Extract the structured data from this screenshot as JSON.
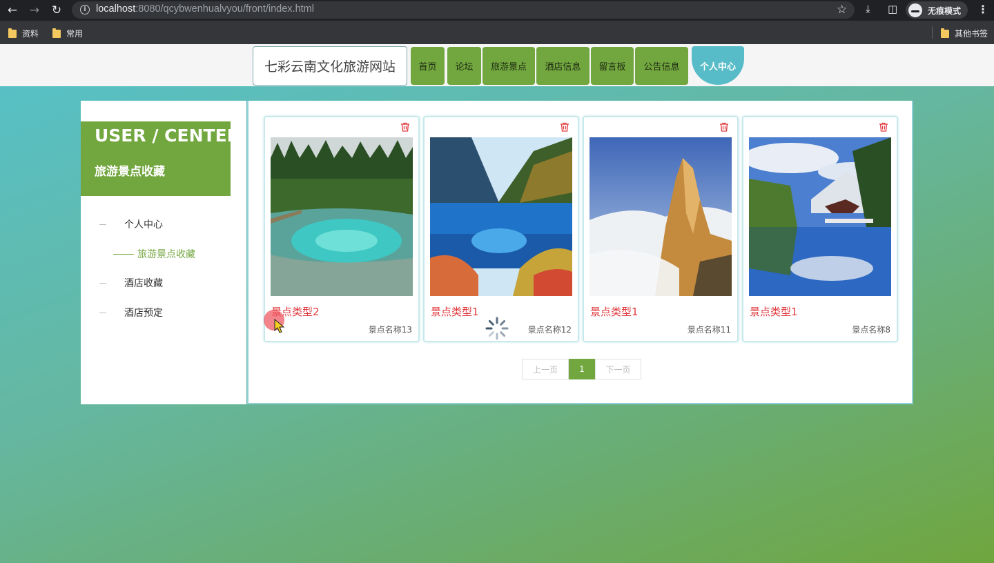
{
  "browser": {
    "url_host": "localhost",
    "url_rest": ":8080/qcybwenhualvyou/front/index.html",
    "incognito_label": "无痕模式",
    "bookmarks": [
      "资料",
      "常用"
    ],
    "other_bookmarks": "其他书签"
  },
  "header": {
    "site_title": "七彩云南文化旅游网站",
    "nav": [
      "首页",
      "论坛",
      "旅游景点",
      "酒店信息",
      "留言板",
      "公告信息",
      "个人中心"
    ],
    "active_nav": "个人中心"
  },
  "sidebar": {
    "title": "USER / CENTER",
    "subtitle": "旅游景点收藏",
    "items": [
      {
        "label": "个人中心",
        "active": false
      },
      {
        "label": "旅游景点收藏",
        "active": true
      },
      {
        "label": "酒店收藏",
        "active": false
      },
      {
        "label": "酒店预定",
        "active": false
      }
    ]
  },
  "cards": [
    {
      "type": "景点类型2",
      "name": "景点名称13",
      "image": "turquoise-lake-forest"
    },
    {
      "type": "景点类型1",
      "name": "景点名称12",
      "image": "blue-valley-lake"
    },
    {
      "type": "景点类型1",
      "name": "景点名称11",
      "image": "peak-above-clouds"
    },
    {
      "type": "景点类型1",
      "name": "景点名称8",
      "image": "pavilion-mountain-reflection"
    }
  ],
  "pagination": {
    "prev": "上一页",
    "current": "1",
    "next": "下一页"
  },
  "colors": {
    "accent_green": "#72a63f",
    "accent_teal": "#57bcc7",
    "card_type_red": "#e0393e"
  }
}
